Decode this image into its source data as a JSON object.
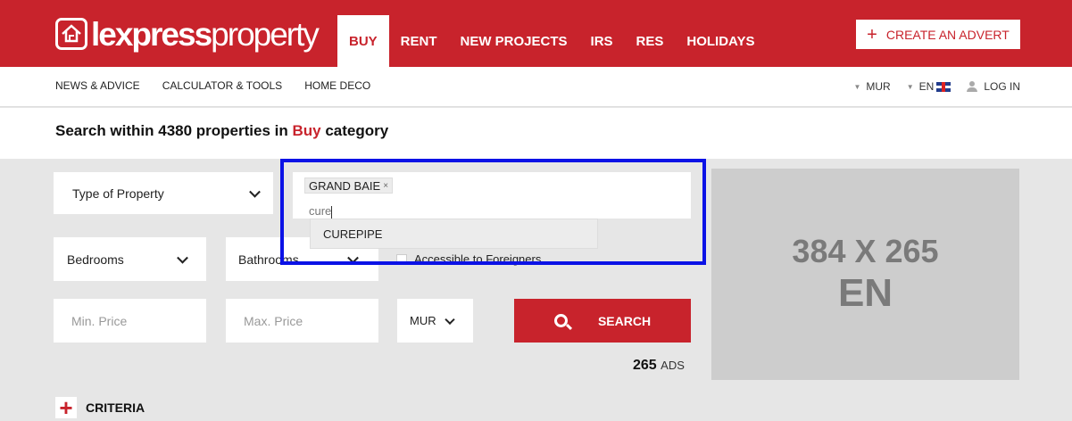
{
  "brand": {
    "logo_bold": "lexpress",
    "logo_light": "property"
  },
  "nav": [
    "BUY",
    "RENT",
    "NEW PROJECTS",
    "IRS",
    "RES",
    "HOLIDAYS"
  ],
  "create_advert": "CREATE AN ADVERT",
  "subnav": [
    "NEWS & ADVICE",
    "CALCULATOR & TOOLS",
    "HOME DECO"
  ],
  "currency": "MUR",
  "language": "EN",
  "login": "LOG IN",
  "headline": {
    "prefix": "Search within 4380 properties in ",
    "category": "Buy",
    "suffix": " category"
  },
  "search": {
    "type_of_property": "Type of Property",
    "bedrooms": "Bedrooms",
    "bathrooms": "Bathrooms",
    "location_tag": "GRAND BAIE",
    "location_tag_remove": "×",
    "location_input": "cure",
    "suggestion": "CUREPIPE",
    "accessible_label": "Accessible to Foreigners",
    "min_price_placeholder": "Min. Price",
    "max_price_placeholder": "Max. Price",
    "price_currency": "MUR",
    "search_button": "SEARCH",
    "ads_count": "265",
    "ads_label": "ADS",
    "criteria": "CRITERIA"
  },
  "ad": {
    "line1": "384 X 265",
    "line2": "EN"
  },
  "colors": {
    "brand_red": "#c8232c",
    "highlight_blue": "#0b12e6"
  }
}
